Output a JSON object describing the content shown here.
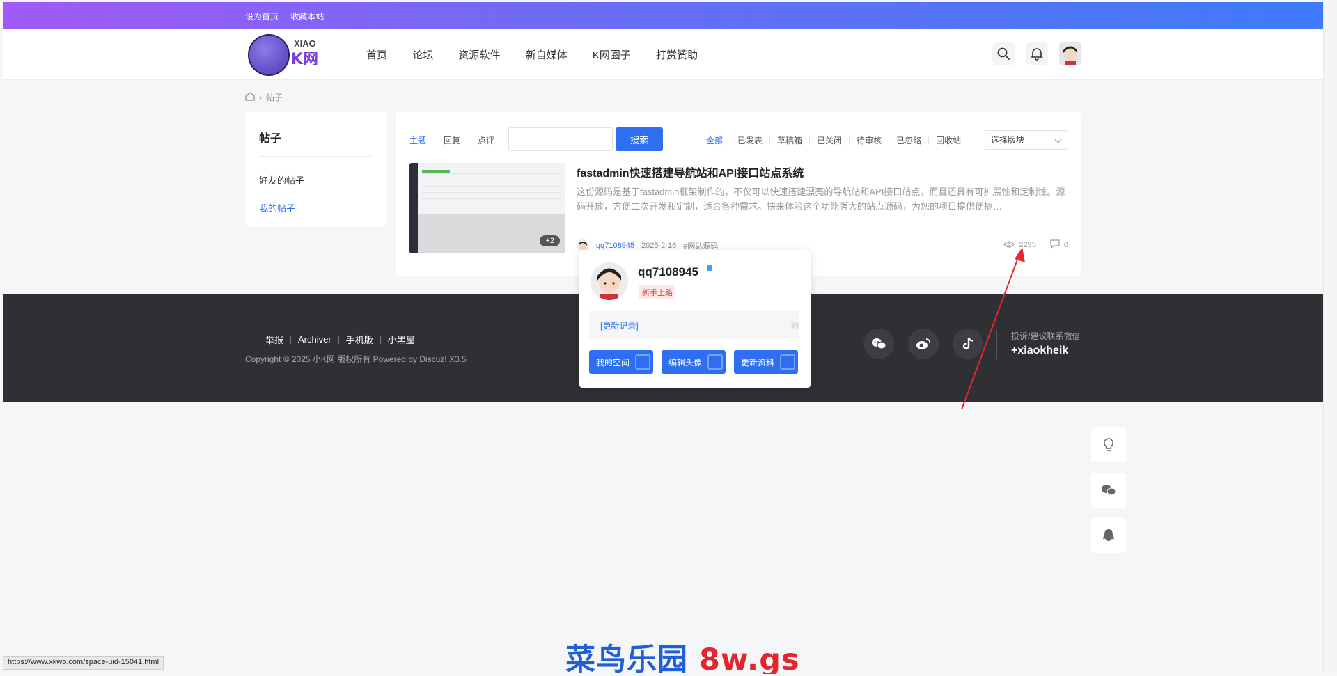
{
  "topbar": {
    "links": [
      "设为首页",
      "收藏本站"
    ]
  },
  "header": {
    "logo": {
      "small": "XIAO",
      "big": "K网"
    },
    "nav": [
      "首页",
      "论坛",
      "资源软件",
      "新自媒体",
      "K网圈子",
      "打赏赞助"
    ]
  },
  "breadcrumb": {
    "current": "帖子"
  },
  "sidebar": {
    "title": "帖子",
    "items": [
      "好友的帖子",
      "我的帖子"
    ]
  },
  "filters": {
    "left_tabs": [
      "主题",
      "回复",
      "点评"
    ],
    "search_placeholder": "",
    "search_button": "搜索",
    "right_tabs": [
      "全部",
      "已发表",
      "草稿箱",
      "已关闭",
      "待审核",
      "已忽略",
      "回收站"
    ],
    "select_label": "选择版块"
  },
  "post": {
    "title": "fastadmin快速搭建导航站和API接口站点系统",
    "description": "这份源码是基于fastadmin框架制作的，不仅可以快速搭建漂亮的导航站和API接口站点，而且还具有可扩展性和定制性。源码开放，方便二次开发和定制，适合各种需求。快来体验这个功能强大的站点源码，为您的项目提供便捷…",
    "thumb_badge": "+2",
    "author": "qq7108945",
    "date": "2025-2-16",
    "tag": "#网站源码",
    "views": "2295",
    "comments": "0"
  },
  "popup": {
    "username": "qq7108945",
    "level": "新手上路",
    "record_link": "[更新记录]",
    "buttons": [
      "我的空间",
      "编辑头像",
      "更新资料"
    ]
  },
  "footer": {
    "links": [
      "举报",
      "Archiver",
      "手机版",
      "小黑屋"
    ],
    "copyright": "Copyright © 2025 小K网 版权所有  Powered by Discuz! X3.5",
    "contact_label": "投诉/建议联系微信",
    "contact_value": "+xiaokheik"
  },
  "status_url": "https://www.xkwo.com/space-uid-15041.html",
  "watermark": {
    "cn": "菜鸟乐园",
    "en": "8w.gs"
  },
  "colors": {
    "accent": "#2e6ff2",
    "footer_bg": "#2f3033",
    "gradient_start": "#a259f7",
    "gradient_end": "#3d7bfa"
  }
}
